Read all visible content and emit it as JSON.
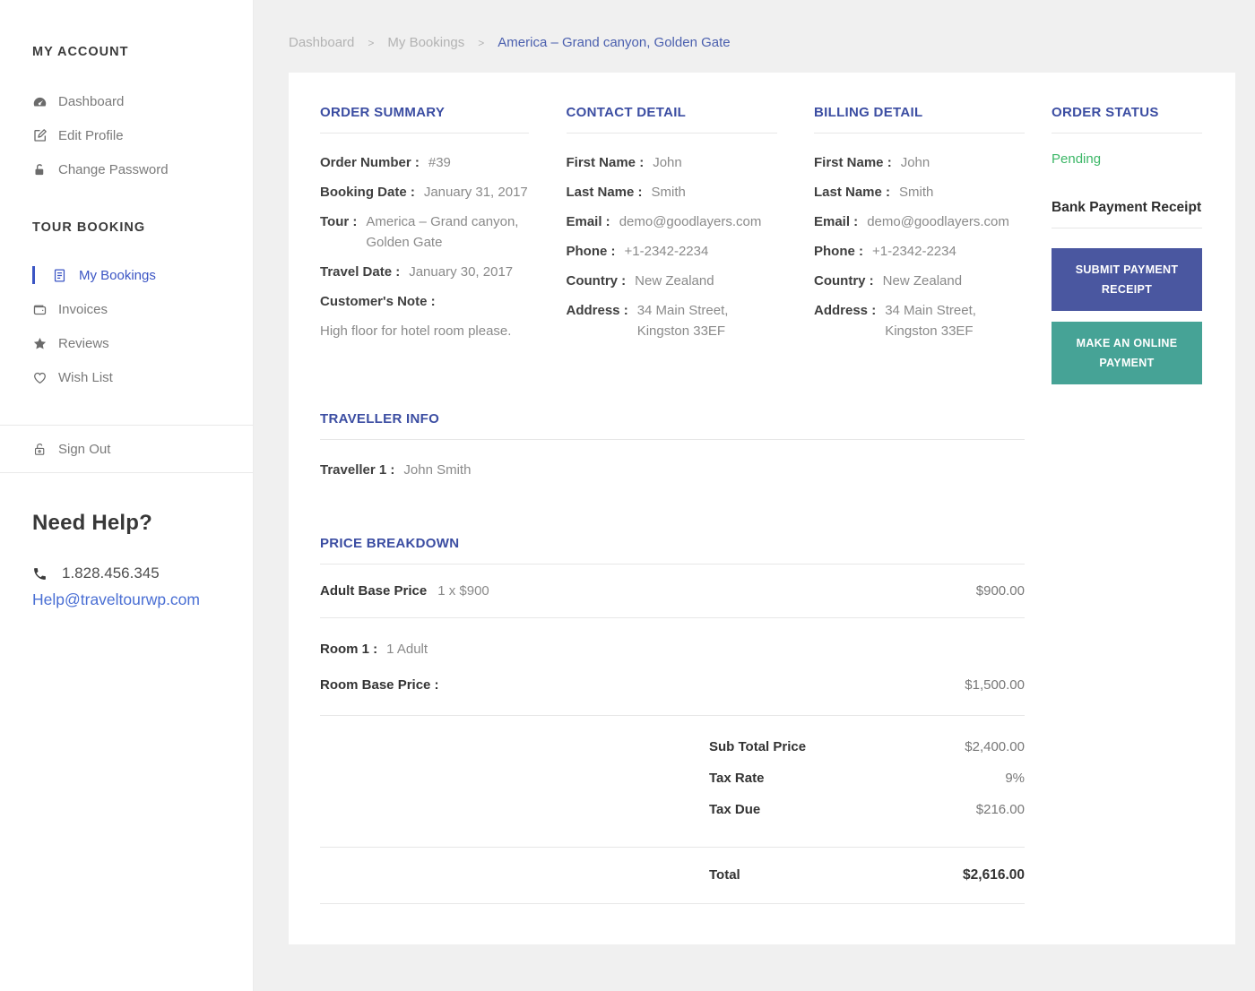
{
  "colors": {
    "page_bg": "#f0f0f0",
    "heading_blue": "#3b4da2",
    "link_blue": "#4a6fd4",
    "active_blue": "#3b55c4",
    "pending_green": "#3cb767",
    "btn_submit_bg": "#4a57a0",
    "btn_online_bg": "#46a396"
  },
  "sidebar": {
    "my_account_heading": "MY ACCOUNT",
    "account_items": [
      {
        "label": "Dashboard",
        "icon": "dashboard-icon"
      },
      {
        "label": "Edit Profile",
        "icon": "edit-icon"
      },
      {
        "label": "Change Password",
        "icon": "lock-icon"
      }
    ],
    "tour_booking_heading": "TOUR BOOKING",
    "booking_items": [
      {
        "label": "My Bookings",
        "icon": "document-icon",
        "active": true
      },
      {
        "label": "Invoices",
        "icon": "wallet-icon"
      },
      {
        "label": "Reviews",
        "icon": "star-icon"
      },
      {
        "label": "Wish List",
        "icon": "heart-icon"
      }
    ],
    "sign_out_label": "Sign Out",
    "need_help": {
      "heading": "Need Help?",
      "phone": "1.828.456.345",
      "email": "Help@traveltourwp.com"
    }
  },
  "breadcrumb": {
    "items": [
      "Dashboard",
      "My Bookings",
      "America – Grand canyon, Golden Gate"
    ],
    "separator": ">"
  },
  "order_summary": {
    "heading": "ORDER SUMMARY",
    "order_number_label": "Order Number :",
    "order_number": "#39",
    "booking_date_label": "Booking Date :",
    "booking_date": "January 31, 2017",
    "tour_label": "Tour :",
    "tour": "America – Grand canyon, Golden Gate",
    "travel_date_label": "Travel Date :",
    "travel_date": "January 30, 2017",
    "customers_note_label": "Customer's Note :",
    "customers_note": "High floor for hotel room please."
  },
  "contact": {
    "heading": "CONTACT DETAIL",
    "fields": [
      {
        "label": "First Name :",
        "value": "John"
      },
      {
        "label": "Last Name :",
        "value": "Smith"
      },
      {
        "label": "Email :",
        "value": "demo@goodlayers.com"
      },
      {
        "label": "Phone :",
        "value": "+1-2342-2234"
      },
      {
        "label": "Country :",
        "value": "New Zealand"
      },
      {
        "label": "Address :",
        "value": "34 Main Street, Kingston 33EF"
      }
    ]
  },
  "billing": {
    "heading": "BILLING DETAIL",
    "fields": [
      {
        "label": "First Name :",
        "value": "John"
      },
      {
        "label": "Last Name :",
        "value": "Smith"
      },
      {
        "label": "Email :",
        "value": "demo@goodlayers.com"
      },
      {
        "label": "Phone :",
        "value": "+1-2342-2234"
      },
      {
        "label": "Country :",
        "value": "New Zealand"
      },
      {
        "label": "Address :",
        "value": "34 Main Street, Kingston 33EF"
      }
    ]
  },
  "order_status": {
    "heading": "ORDER STATUS",
    "status": "Pending",
    "bank_receipt_label": "Bank Payment Receipt",
    "submit_button": "SUBMIT PAYMENT RECEIPT",
    "online_button": "MAKE AN ONLINE PAYMENT"
  },
  "traveller": {
    "heading": "TRAVELLER INFO",
    "label": "Traveller 1 :",
    "value": "John Smith"
  },
  "price": {
    "heading": "PRICE BREAKDOWN",
    "adult_label": "Adult Base Price",
    "adult_qty": "1 x $900",
    "adult_amount": "$900.00",
    "room_label": "Room 1 :",
    "room_value": "1 Adult",
    "room_base_label": "Room Base Price :",
    "room_base_amount": "$1,500.00",
    "subtotal_label": "Sub Total Price",
    "subtotal": "$2,400.00",
    "tax_rate_label": "Tax Rate",
    "tax_rate": "9%",
    "tax_due_label": "Tax Due",
    "tax_due": "$216.00",
    "total_label": "Total",
    "total": "$2,616.00"
  }
}
